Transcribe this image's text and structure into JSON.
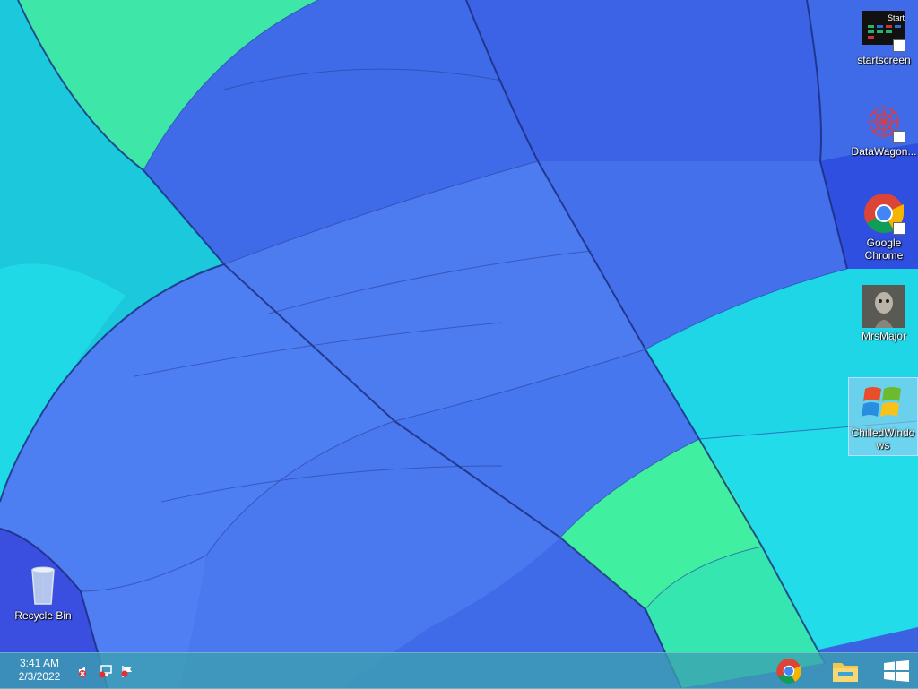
{
  "desktop": {
    "icons": [
      {
        "name": "startscreen-icon",
        "label": "startscreen",
        "preview_text": "Start"
      },
      {
        "name": "datawagon-icon",
        "label": "DataWagon..."
      },
      {
        "name": "google-chrome-icon",
        "label": "Google Chrome"
      },
      {
        "name": "mrsmajor-icon",
        "label": "MrsMajor"
      },
      {
        "name": "chilledwindows-icon",
        "label": "ChilledWindows"
      },
      {
        "name": "recycle-bin-icon",
        "label": "Recycle Bin"
      }
    ]
  },
  "taskbar": {
    "clock": {
      "time": "3:41 AM",
      "date": "2/3/2022"
    },
    "tray": [
      "volume-muted-icon",
      "network-error-icon",
      "action-center-flag-icon"
    ],
    "pinned": [
      "chrome-icon",
      "file-explorer-icon"
    ],
    "start": "windows-start-icon"
  },
  "colors": {
    "wallpaper_blue": "#3f6fe6",
    "wallpaper_cyan": "#1fd9e0",
    "wallpaper_green": "#3ef0a0",
    "taskbar": "#3ca0af"
  }
}
